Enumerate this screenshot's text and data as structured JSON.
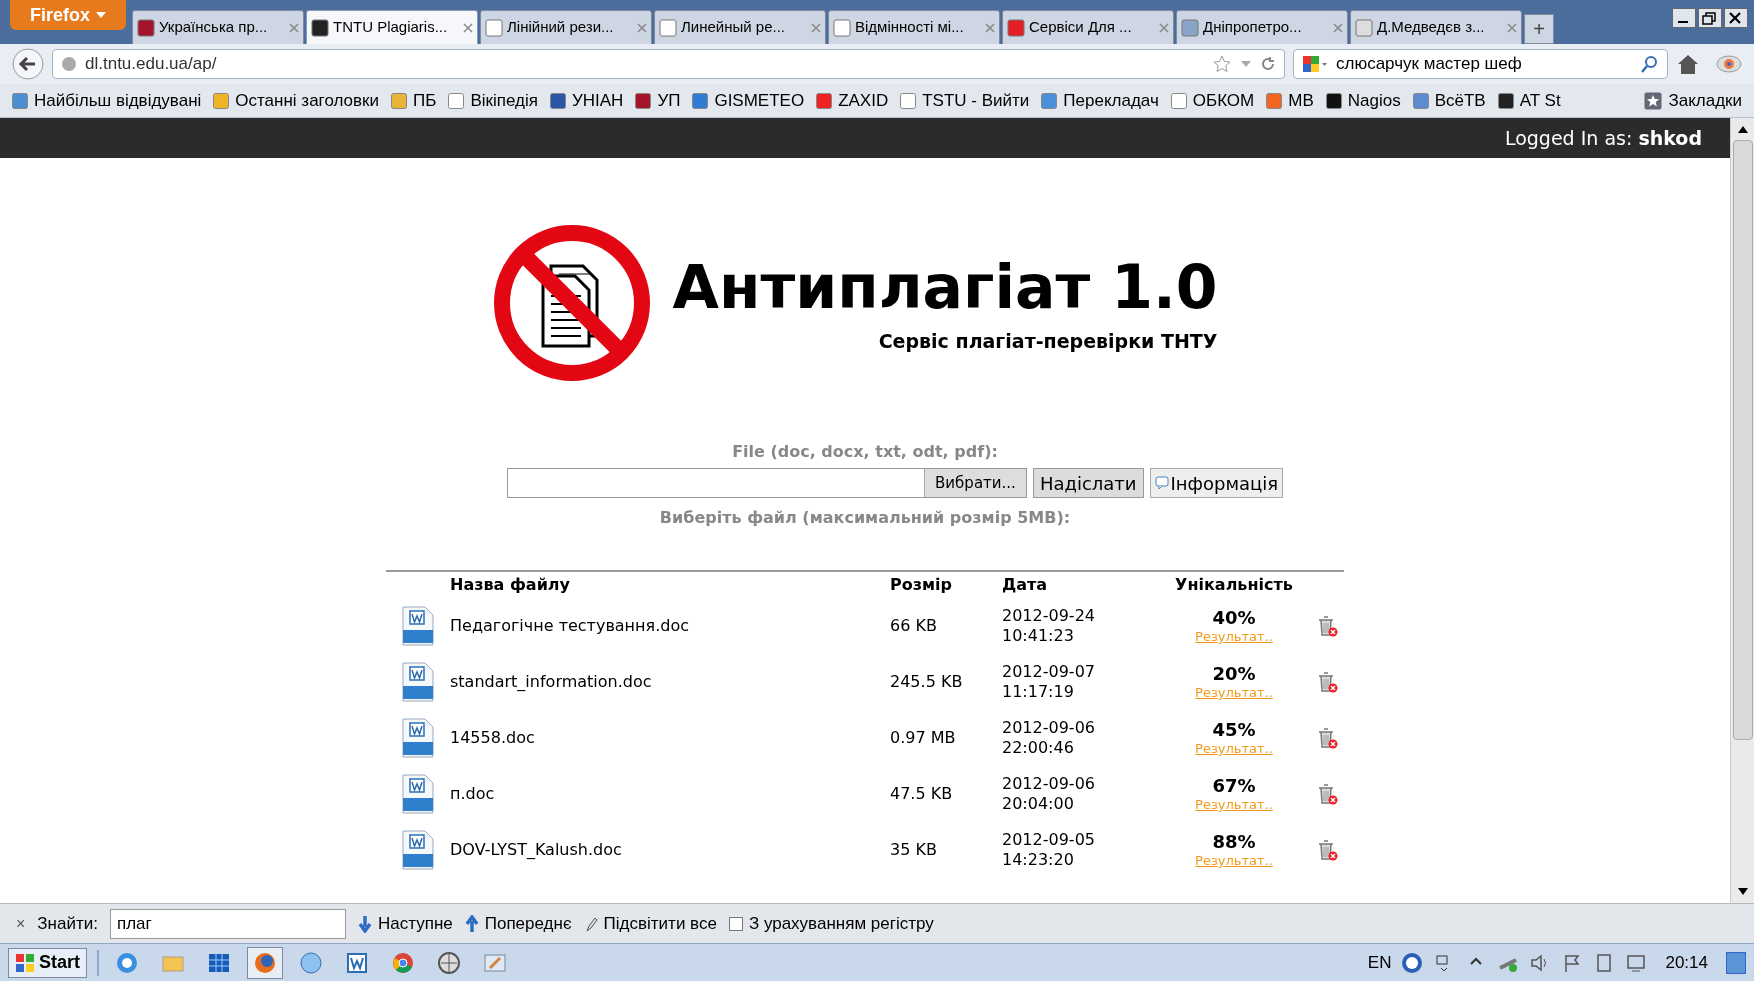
{
  "browser": {
    "menu_button": "Firefox",
    "tabs": [
      {
        "label": "Українська пр...",
        "selected": false
      },
      {
        "label": "TNTU Plagiaris...",
        "selected": true
      },
      {
        "label": "Лінійний рези...",
        "selected": false
      },
      {
        "label": "Линейный ре...",
        "selected": false
      },
      {
        "label": "Відмінності мі...",
        "selected": false
      },
      {
        "label": "Сервіси Для ...",
        "selected": false
      },
      {
        "label": "Дніпропетро...",
        "selected": false
      },
      {
        "label": "Д.Медведєв з...",
        "selected": false
      }
    ],
    "new_tab": "+",
    "url": "dl.tntu.edu.ua/ap/",
    "search": "слюсарчук мастер шеф",
    "bookmarks": [
      "Найбільш відвідувані",
      "Останні заголовки",
      "ПБ",
      "Вікіпедія",
      "УНІАН",
      "УП",
      "GISMETEO",
      "ZAXID",
      "TSTU - Вийти",
      "Перекладач",
      "ОБКОМ",
      "МВ",
      "Nagios",
      "ВсёТВ",
      "AT St"
    ],
    "bookmarks_menu": "Закладки"
  },
  "page": {
    "logged_in": "Logged In as: **shkod**",
    "title": "Антиплагіат 1.0",
    "subtitle": "Сервіс плагіат-перевірки ТНТУ",
    "file_label": "File (doc, docx, txt, odt, pdf):",
    "browse_button": "Вибрати...",
    "send_button": "Надіслати",
    "info_button": "Інформація",
    "hint": "Виберіть файл (максимальний розмір 5MB):",
    "table": {
      "columns": [
        "Назва файлу",
        "Розмір",
        "Дата",
        "Унікальність"
      ],
      "rows": [
        {
          "name": "Педагогічне тестування.doc",
          "size": "66 KB",
          "date": "2012-09-24",
          "time": "10:41:23",
          "uniqueness": "40%",
          "link": "Результат.."
        },
        {
          "name": "standart_information.doc",
          "size": "245.5 KB",
          "date": "2012-09-07",
          "time": "11:17:19",
          "uniqueness": "20%",
          "link": "Результат.."
        },
        {
          "name": "14558.doc",
          "size": "0.97 MB",
          "date": "2012-09-06",
          "time": "22:00:46",
          "uniqueness": "45%",
          "link": "Результат.."
        },
        {
          "name": "п.doc",
          "size": "47.5 KB",
          "date": "2012-09-06",
          "time": "20:04:00",
          "uniqueness": "67%",
          "link": "Результат.."
        },
        {
          "name": "DOV-LYST_Kalush.doc",
          "size": "35 KB",
          "date": "2012-09-05",
          "time": "14:23:20",
          "uniqueness": "88%",
          "link": "Результат.."
        }
      ]
    }
  },
  "find_bar": {
    "close": "×",
    "label": "Знайти:",
    "value": "плаг",
    "next": "Наступне",
    "previous": "Попереднє",
    "highlight": "Підсвітити все",
    "match_case": {
      "label": "З урахуванням регістру",
      "checked": false
    }
  },
  "taskbar": {
    "start": "Start",
    "language": "EN",
    "clock": "20:14"
  }
}
